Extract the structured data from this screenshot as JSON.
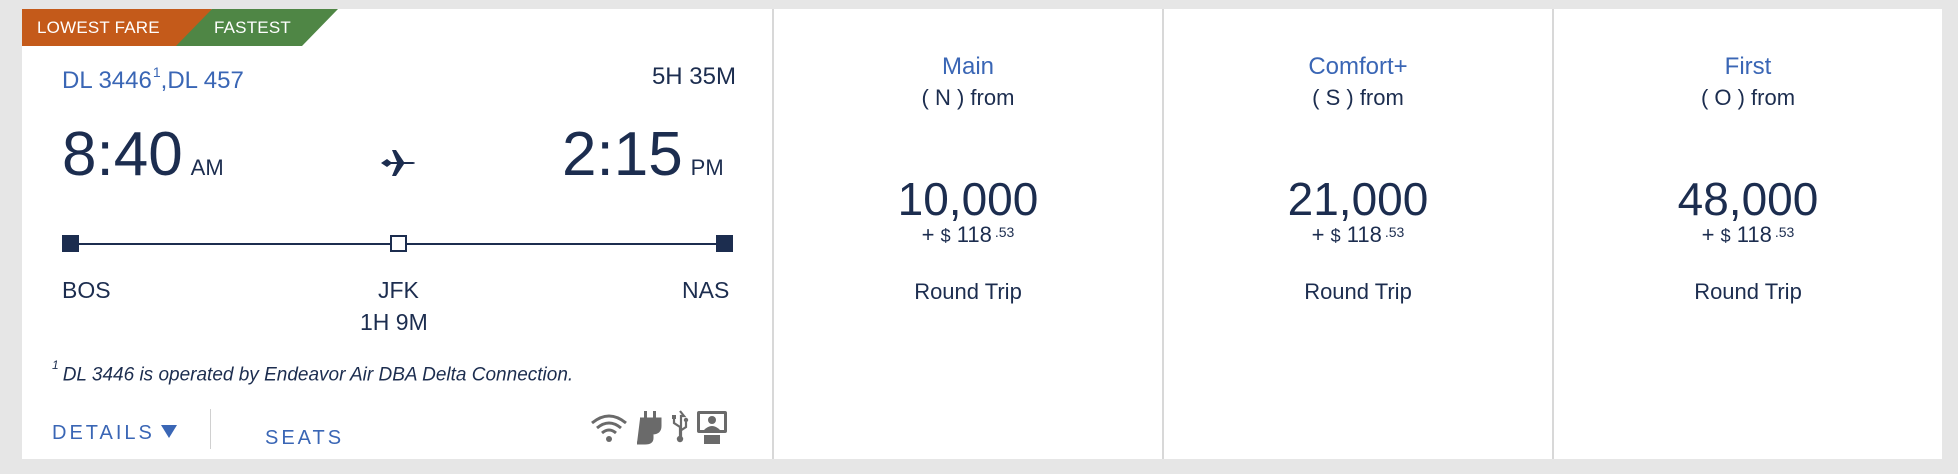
{
  "badges": {
    "lowest": "LOWEST FARE",
    "fastest": "FASTEST",
    "lowest_color": "#c45a1a",
    "fastest_color": "#4f8645"
  },
  "flight": {
    "number1": "DL 3446",
    "footnote_marker": "1",
    "number2": ",DL 457",
    "duration": "5H 35M",
    "depart_time": "8:40",
    "depart_ampm": "AM",
    "arrive_time": "2:15",
    "arrive_ampm": "PM",
    "origin": "BOS",
    "stop": "JFK",
    "layover": "1H 9M",
    "destination": "NAS"
  },
  "footnote": {
    "marker": "1",
    "text": "DL 3446 is operated by Endeavor Air DBA Delta Connection."
  },
  "actions": {
    "details": "DETAILS",
    "seats": "SEATS"
  },
  "amenity_icons": [
    "wifi-icon",
    "power-plug-icon",
    "usb-icon",
    "personal-video-icon"
  ],
  "fares": [
    {
      "cabin": "Main",
      "code": "( N ) from",
      "miles": "10,000",
      "plus": "+",
      "currency": "$",
      "dollars": "118",
      "cents": ".53",
      "trip": "Round Trip"
    },
    {
      "cabin": "Comfort+",
      "code": "( S ) from",
      "miles": "21,000",
      "plus": "+",
      "currency": "$",
      "dollars": "118",
      "cents": ".53",
      "trip": "Round Trip"
    },
    {
      "cabin": "First",
      "code": "( O ) from",
      "miles": "48,000",
      "plus": "+",
      "currency": "$",
      "dollars": "118",
      "cents": ".53",
      "trip": "Round Trip"
    }
  ],
  "colors": {
    "link_blue": "#3a66b5",
    "navy": "#1c2d4f"
  }
}
